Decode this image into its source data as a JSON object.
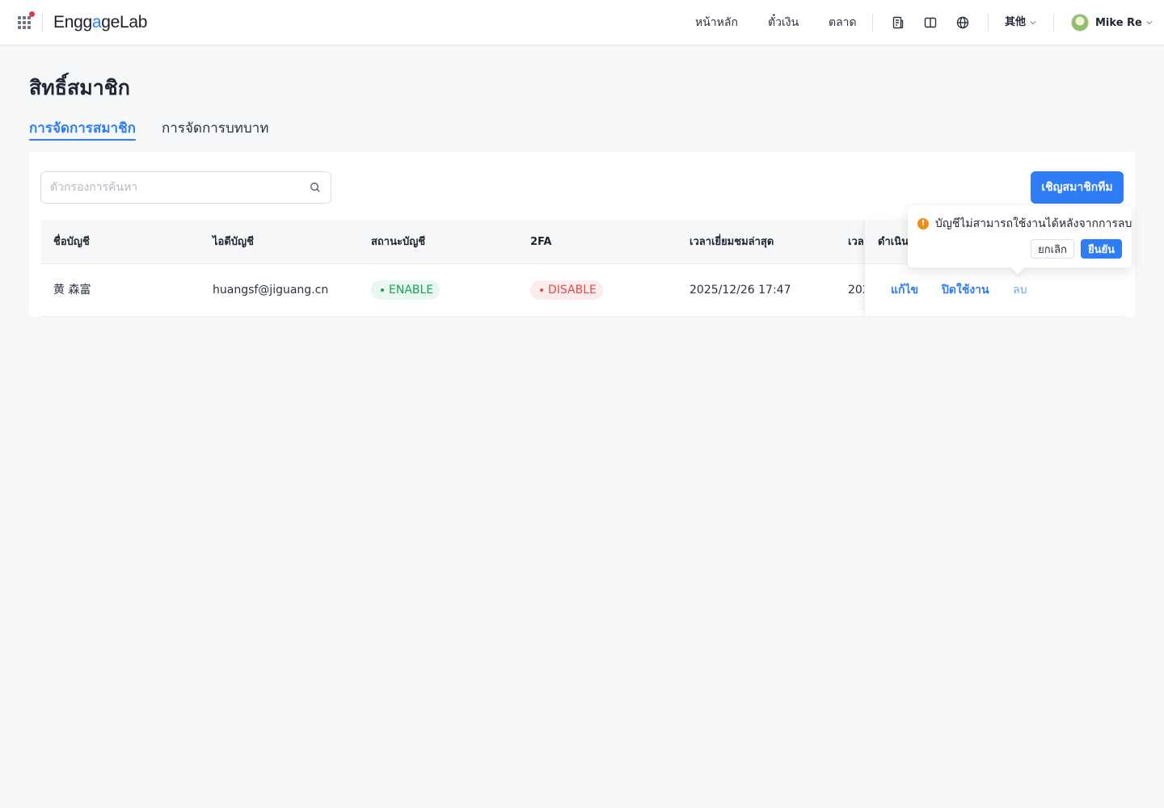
{
  "header": {
    "logo": {
      "eng": "Eng",
      "g": "g",
      "a": "a",
      "ge": "ge",
      "lab": "Lab"
    },
    "nav": [
      "หน้าหลัก",
      "ตั๋วเงิน",
      "ตลาด"
    ],
    "icons": [
      "document-icon",
      "book-icon",
      "globe-icon"
    ],
    "more_label": "其他",
    "user_name": "Mike Re"
  },
  "page": {
    "title": "สิทธิ์สมาชิก",
    "tabs": [
      {
        "label": "การจัดการสมาชิก",
        "active": true
      },
      {
        "label": "การจัดการบทบาท",
        "active": false
      }
    ]
  },
  "search": {
    "placeholder": "ตัวกรองการค้นหา",
    "value": ""
  },
  "invite_label": "เชิญสมาชิกทีม",
  "table": {
    "columns": [
      "ชื่อบัญชี",
      "ไอดีบัญชี",
      "สถานะบัญชี",
      "2FA",
      "เวลาเยี่ยมชมล่าสุด",
      "เวลา",
      "ดำเนิน"
    ],
    "rows": [
      {
        "name": "黄 森富",
        "account_id": "huangsf@jiguang.cn",
        "status": "ENABLE",
        "twofa": "DISABLE",
        "last_visit": "2025/12/26 17:47",
        "time_col": "202",
        "actions": [
          "แก้ไข",
          "ปิดใช้งาน",
          "ลบ"
        ]
      }
    ]
  },
  "popconfirm": {
    "message": "บัญชีไม่สามารถใช้งานได้หลังจากการลบ",
    "icon": "!",
    "cancel": "ยกเลิก",
    "confirm": "ยืนยัน"
  },
  "colors": {
    "primary": "#2e7cf6",
    "enable": "#17a35a",
    "disable": "#e24b4b",
    "warning": "#f08c1a",
    "logo_dot": "#e5364f"
  }
}
